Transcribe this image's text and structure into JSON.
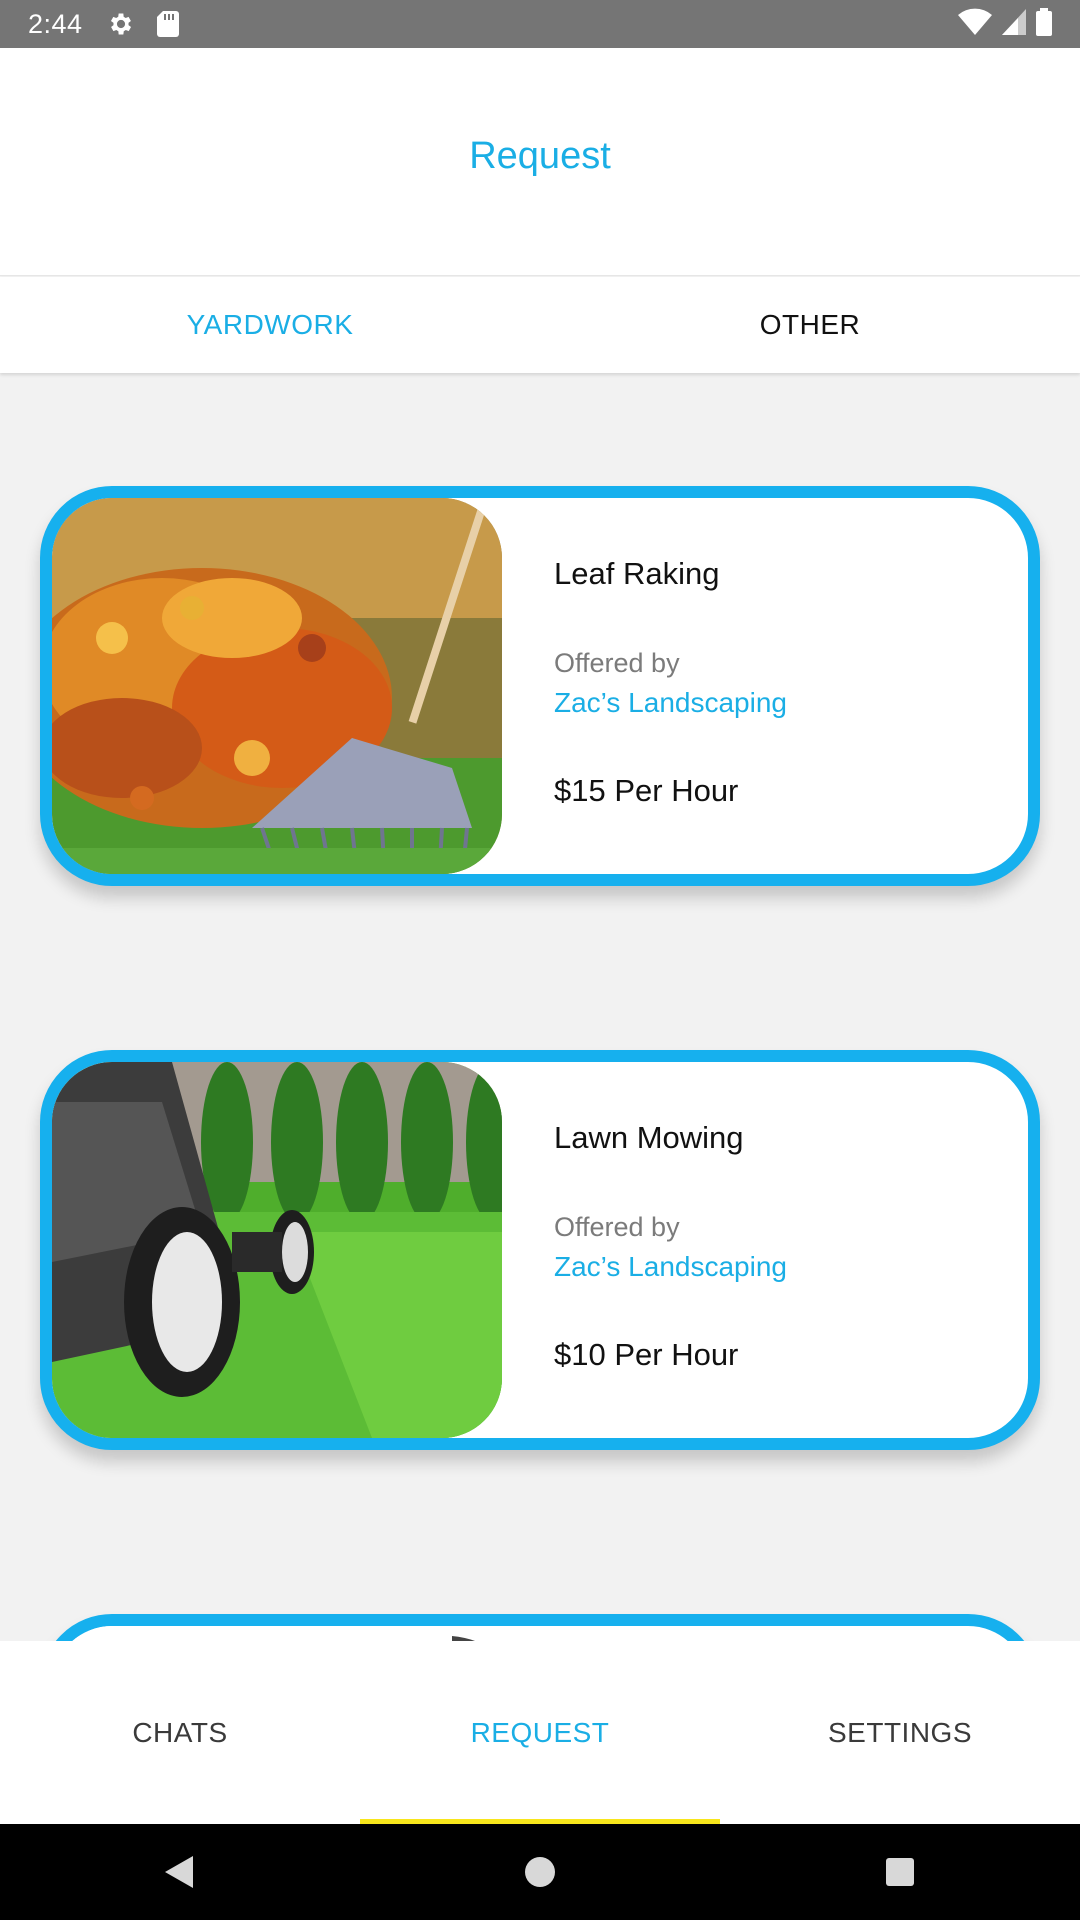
{
  "status_bar": {
    "time": "2:44",
    "icons": [
      "gear-icon",
      "sd-card-icon",
      "wifi-icon",
      "signal-icon",
      "battery-icon"
    ]
  },
  "app_bar": {
    "title": "Request"
  },
  "tabs": [
    {
      "label": "YARDWORK",
      "active": true
    },
    {
      "label": "OTHER",
      "active": false
    }
  ],
  "cards": [
    {
      "title": "Leaf Raking",
      "offered_label": "Offered by",
      "provider": "Zac’s Landscaping",
      "price": "$15 Per Hour",
      "image": "leaf-raking-photo"
    },
    {
      "title": "Lawn Mowing",
      "offered_label": "Offered by",
      "provider": "Zac’s Landscaping",
      "price": "$10 Per Hour",
      "image": "lawn-mowing-photo"
    }
  ],
  "bottom_nav": [
    {
      "label": "CHATS",
      "active": false
    },
    {
      "label": "REQUEST",
      "active": true
    },
    {
      "label": "SETTINGS",
      "active": false
    }
  ],
  "colors": {
    "accent": "#1aaee5",
    "card_border": "#16b0ee",
    "indicator": "#f8e61c",
    "status_bar": "#757575"
  },
  "system_nav": [
    "back-icon",
    "home-icon",
    "recents-icon"
  ]
}
